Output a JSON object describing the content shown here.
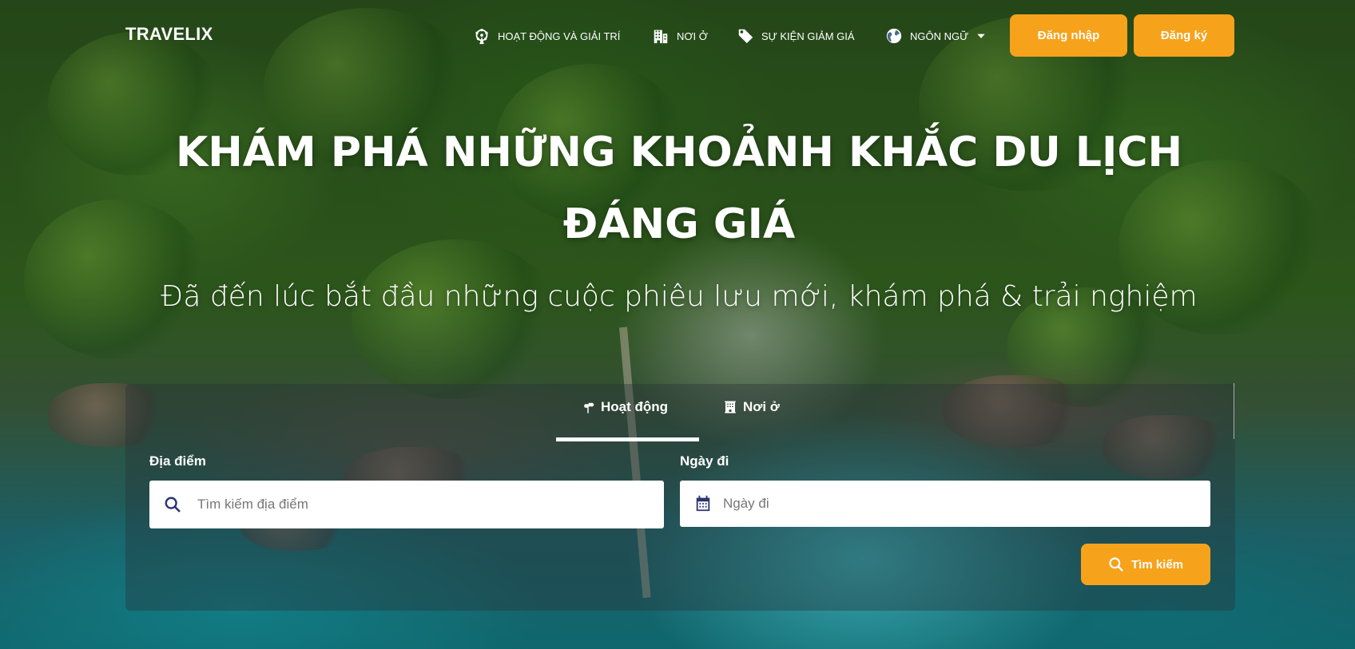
{
  "brand": {
    "name": "TRAVELIX"
  },
  "nav": {
    "activities": {
      "label": "HOẠT ĐỘNG VÀ GIẢI TRÍ",
      "icon": "ferris-wheel-icon"
    },
    "stays": {
      "label": "NƠI Ở",
      "icon": "building-icon"
    },
    "deals": {
      "label": "SỰ KIỆN GIẢM GIÁ",
      "icon": "tag-icon"
    },
    "language": {
      "label": "NGÔN NGỮ",
      "icon": "globe-icon",
      "dropdown_icon": "caret-down-icon"
    }
  },
  "auth": {
    "login_label": "Đăng nhập",
    "signup_label": "Đăng ký"
  },
  "hero": {
    "headline": "KHÁM PHÁ NHỮNG KHOẢNH KHẮC DU LỊCH ĐÁNG GIÁ",
    "subtitle": "Đã đến lúc bắt đầu những cuộc phiêu lưu mới, khám phá & trải nghiệm"
  },
  "search": {
    "tabs": [
      {
        "label": "Hoạt động",
        "icon": "signpost-icon",
        "active": true
      },
      {
        "label": "Nơi ở",
        "icon": "hotel-icon",
        "active": false
      }
    ],
    "location": {
      "label": "Địa điểm",
      "placeholder": "Tìm kiếm địa điểm",
      "value": ""
    },
    "date": {
      "label": "Ngày đi",
      "placeholder": "Ngày đi",
      "value": ""
    },
    "submit_label": "Tìm kiếm"
  },
  "colors": {
    "accent": "#f7a21b",
    "panel": "#283237",
    "icon_navy": "#2c3570"
  }
}
